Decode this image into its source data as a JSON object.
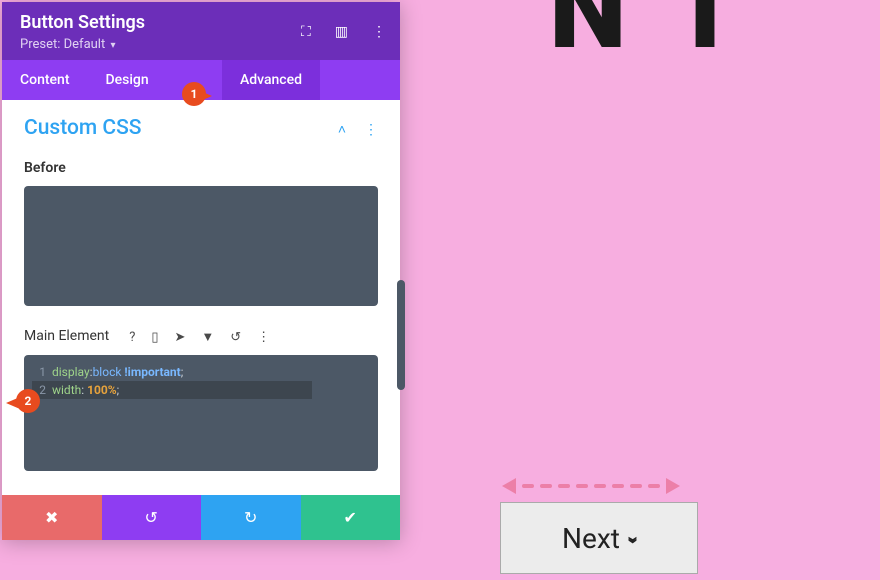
{
  "bg_text": "N T",
  "header": {
    "title": "Button Settings",
    "preset_label": "Preset:",
    "preset_value": "Default"
  },
  "tabs": {
    "content": "Content",
    "design": "Design",
    "advanced": "Advanced"
  },
  "callouts": {
    "c1": "1",
    "c2": "2"
  },
  "section": {
    "title": "Custom CSS",
    "before_label": "Before",
    "main_label": "Main Element"
  },
  "code": {
    "line1": {
      "no": "1",
      "prop": "display",
      "colon": ":",
      "val": "block",
      "imp": " !important",
      "semi": ";"
    },
    "line2": {
      "no": "2",
      "prop": "width",
      "colon": ": ",
      "val": "100%",
      "semi": ";"
    }
  },
  "next": {
    "label": "Next"
  },
  "icons": {
    "expand": "⛶",
    "columns": "▥",
    "more": "⋮",
    "chevup": "˄",
    "help": "?",
    "mobile": "▯",
    "pointer": "➤",
    "pin": "▼",
    "undo": "↺",
    "close": "✖",
    "refresh": "↻",
    "check": "✔"
  }
}
